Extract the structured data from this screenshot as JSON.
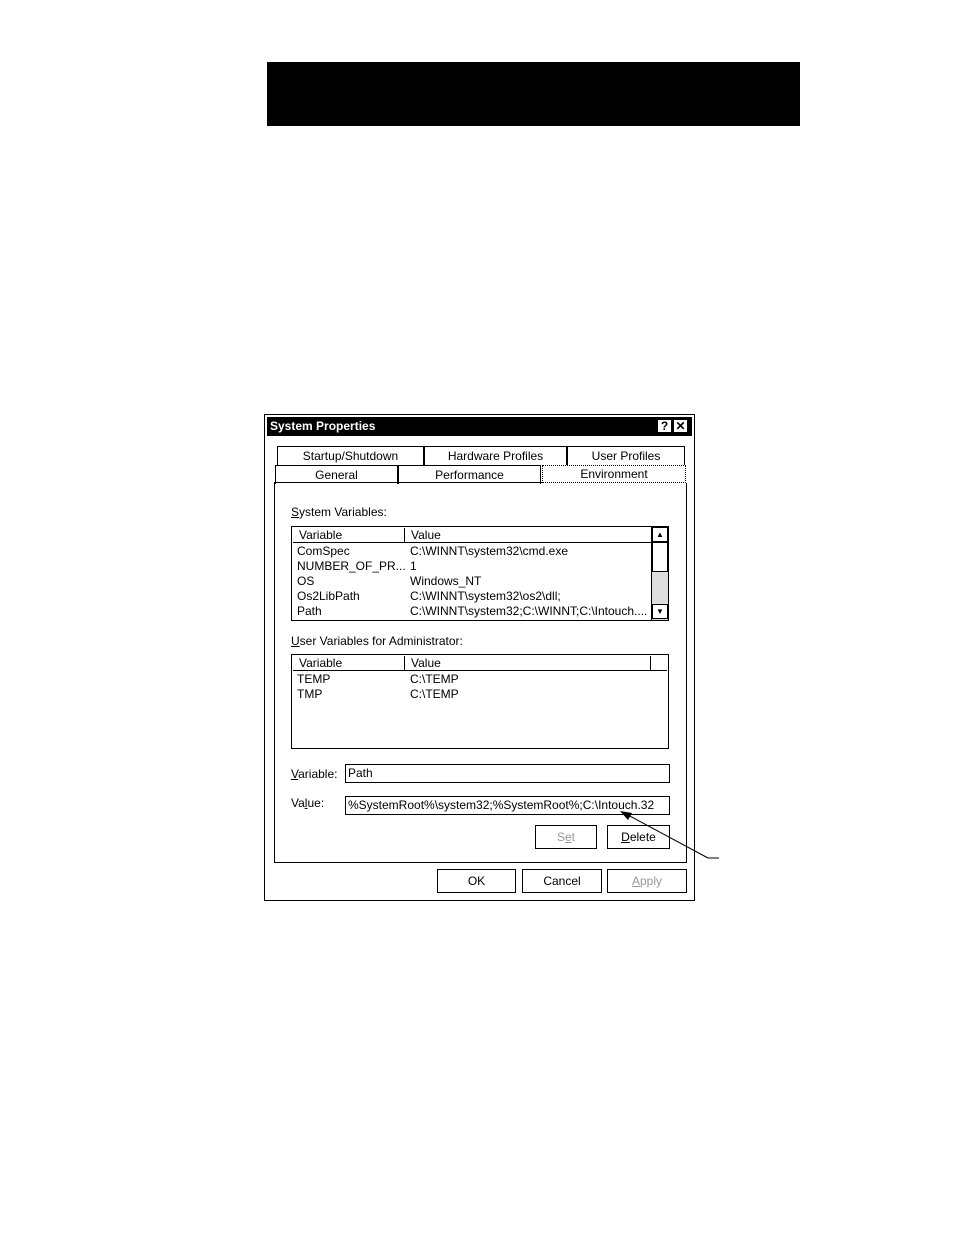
{
  "dialog": {
    "title": "System Properties",
    "help_glyph": "?",
    "close_glyph": "✕",
    "tabs_row1": [
      "Startup/Shutdown",
      "Hardware Profiles",
      "User Profiles"
    ],
    "tabs_row2": [
      "General",
      "Performance",
      "Environment"
    ],
    "active_tab": "Environment"
  },
  "system_variables": {
    "label_mnemonic": "S",
    "label_rest": "ystem Variables:",
    "columns": [
      "Variable",
      "Value"
    ],
    "rows": [
      [
        "ComSpec",
        "C:\\WINNT\\system32\\cmd.exe"
      ],
      [
        "NUMBER_OF_PR...",
        "1"
      ],
      [
        "OS",
        "Windows_NT"
      ],
      [
        "Os2LibPath",
        "C:\\WINNT\\system32\\os2\\dll;"
      ],
      [
        "Path",
        "C:\\WINNT\\system32;C:\\WINNT;C:\\Intouch...."
      ]
    ]
  },
  "user_variables": {
    "label_mnemonic": "U",
    "label_rest": "ser Variables for Administrator:",
    "columns": [
      "Variable",
      "Value"
    ],
    "rows": [
      [
        "TEMP",
        "C:\\TEMP"
      ],
      [
        "TMP",
        "C:\\TEMP"
      ]
    ]
  },
  "variable_field": {
    "label_mnemonic": "V",
    "label_rest": "ariable:",
    "value": "Path"
  },
  "value_field": {
    "label_pre": "Va",
    "label_mnemonic": "l",
    "label_rest": "ue:",
    "value": "%SystemRoot%\\system32;%SystemRoot%;C:\\Intouch.32"
  },
  "buttons": {
    "set_pre": "S",
    "set_mnemonic": "e",
    "set_rest": "t",
    "delete_mnemonic": "D",
    "delete_rest": "elete",
    "ok": "OK",
    "cancel": "Cancel",
    "apply_mnemonic": "A",
    "apply_rest": "pply"
  }
}
